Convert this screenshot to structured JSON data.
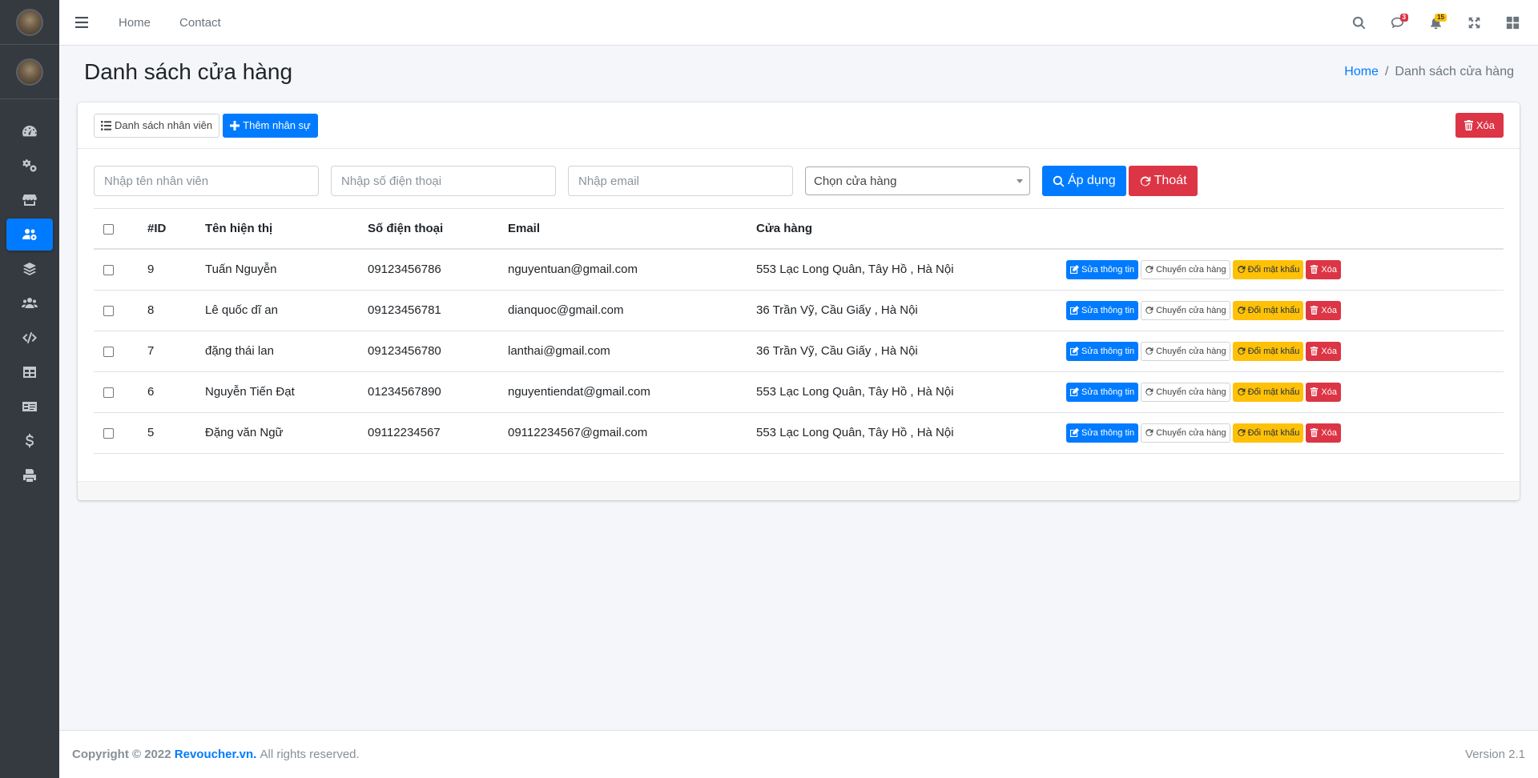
{
  "sidebar": {
    "items": [
      {
        "name": "dashboard-icon",
        "active": false
      },
      {
        "name": "cogs-icon",
        "active": false
      },
      {
        "name": "store-icon",
        "active": false
      },
      {
        "name": "users-cog-icon",
        "active": true
      },
      {
        "name": "layers-icon",
        "active": false
      },
      {
        "name": "users-icon",
        "active": false
      },
      {
        "name": "code-icon",
        "active": false
      },
      {
        "name": "table-icon",
        "active": false
      },
      {
        "name": "id-card-icon",
        "active": false
      },
      {
        "name": "dollar-icon",
        "active": false
      },
      {
        "name": "print-icon",
        "active": false
      }
    ]
  },
  "navbar": {
    "links": [
      "Home",
      "Contact"
    ],
    "messages_badge": "3",
    "notifications_badge": "15"
  },
  "header": {
    "title": "Danh sách cửa hàng",
    "breadcrumb_home": "Home",
    "breadcrumb_sep": "/",
    "breadcrumb_current": "Danh sách cửa hàng"
  },
  "toolbar": {
    "list_label": "Danh sách nhân viên",
    "add_label": "Thêm nhân sự",
    "delete_label": "Xóa"
  },
  "filters": {
    "name_placeholder": "Nhập tên nhân viên",
    "phone_placeholder": "Nhập số điện thoại",
    "email_placeholder": "Nhập email",
    "store_select": "Chọn cửa hàng",
    "apply_label": "Áp dụng",
    "exit_label": "Thoát"
  },
  "table": {
    "headers": [
      "#ID",
      "Tên hiện thị",
      "Số điện thoại",
      "Email",
      "Cửa hàng"
    ],
    "actions": {
      "edit": "Sửa thông tin",
      "move": "Chuyển cửa hàng",
      "password": "Đổi mật khẩu",
      "delete": "Xóa"
    },
    "rows": [
      {
        "id": "9",
        "name": "Tuấn Nguyễn",
        "phone": "09123456786",
        "email": "nguyentuan@gmail.com",
        "store": "553 Lạc Long Quân, Tây Hồ , Hà Nội"
      },
      {
        "id": "8",
        "name": "Lê quốc dĩ an",
        "phone": "09123456781",
        "email": "dianquoc@gmail.com",
        "store": "36 Trần Vỹ, Cầu Giấy , Hà Nội"
      },
      {
        "id": "7",
        "name": "đặng thái lan",
        "phone": "09123456780",
        "email": "lanthai@gmail.com",
        "store": "36 Trần Vỹ, Cầu Giấy , Hà Nội"
      },
      {
        "id": "6",
        "name": "Nguyễn Tiến Đạt",
        "phone": "01234567890",
        "email": "nguyentiendat@gmail.com",
        "store": "553 Lạc Long Quân, Tây Hồ , Hà Nội"
      },
      {
        "id": "5",
        "name": "Đặng văn Ngữ",
        "phone": "09112234567",
        "email": "09112234567@gmail.com",
        "store": "553 Lạc Long Quân, Tây Hồ , Hà Nội"
      }
    ]
  },
  "footer": {
    "copyright": "Copyright © 2022",
    "brand": "Revoucher.vn.",
    "rights": "All rights reserved.",
    "version": "Version 2.1"
  },
  "colors": {
    "primary": "#007bff",
    "danger": "#dc3545",
    "warning": "#ffc107",
    "sidebar": "#343a40"
  }
}
